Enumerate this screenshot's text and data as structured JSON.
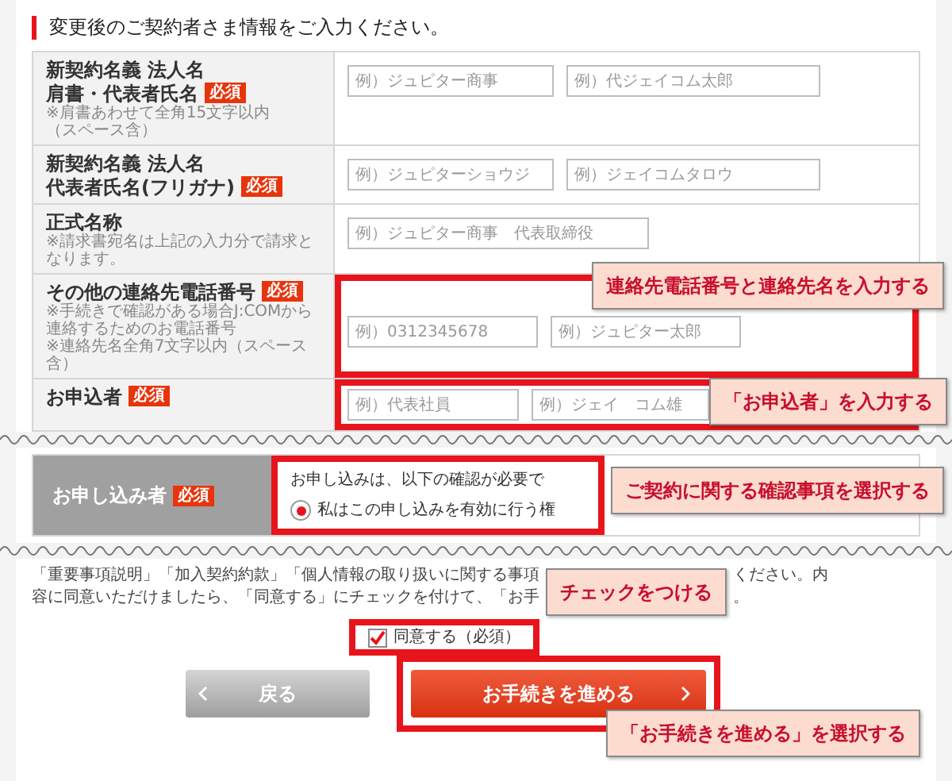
{
  "heading": "変更後のご契約者さま情報をご入力ください。",
  "rows": [
    {
      "label_lines": [
        "新契約名義 法人名",
        "肩書・代表者氏名"
      ],
      "badge": "必須",
      "notes": [
        "※肩書あわせて全角15文字以内",
        "（スペース含）"
      ],
      "fields": [
        {
          "placeholder": "例）ジュピター商事"
        },
        {
          "placeholder": "例）代ジェイコム太郎"
        }
      ],
      "highlighted": false
    },
    {
      "label_lines": [
        "新契約名義 法人名",
        "代表者氏名(フリガナ)"
      ],
      "badge": "必須",
      "notes": [],
      "fields": [
        {
          "placeholder": "例）ジュピターショウジ"
        },
        {
          "placeholder": "例）ジェイコムタロウ"
        }
      ],
      "highlighted": false
    },
    {
      "label_lines": [
        "正式名称"
      ],
      "notes": [
        "※請求書宛名は上記の入力分で請求となります。"
      ],
      "fields": [
        {
          "placeholder": "例）ジュピター商事　代表取締役"
        }
      ],
      "highlighted": false
    },
    {
      "label_lines": [
        "その他の連絡先電話番号"
      ],
      "badge": "必須",
      "notes": [
        "※手続きで確認がある場合J:COMから連絡するためのお電話番号",
        "※連絡先名全角7文字以内（スペース含）"
      ],
      "fields": [
        {
          "placeholder": "例）0312345678"
        },
        {
          "placeholder": "例）ジュピター太郎"
        }
      ],
      "highlighted": true,
      "callout": "連絡先電話番号と連絡先名を入力する"
    },
    {
      "label_lines": [
        "お申込者"
      ],
      "badge": "必須",
      "notes": [],
      "fields": [
        {
          "placeholder": "例）代表社員"
        },
        {
          "placeholder": "例）ジェイ　コム雄"
        }
      ],
      "highlighted": true,
      "callout": "「お申込者」を入力する"
    }
  ],
  "applicant": {
    "label": "お申し込み者",
    "badge": "必須",
    "text": "お申し込みは、以下の確認が必要で",
    "radio": {
      "label": "私はこの申し込みを有効に行う権",
      "selected": true
    },
    "highlighted": true,
    "callout": "ご契約に関する確認事項を選択する"
  },
  "agreement": {
    "lines_left": [
      "「重要事項説明」「加入契約約款」「個人情報の取り扱いに関する事項",
      "容に同意いただけましたら、「同意する」にチェックを付けて、「お手"
    ],
    "lines_right": [
      "ください。内",
      "。"
    ],
    "callout": "チェックをつける",
    "checkbox": {
      "label": "同意する（必須）",
      "checked": true,
      "highlighted": true
    }
  },
  "buttons": [
    {
      "kind": "back",
      "label": "戻る",
      "highlighted": false
    },
    {
      "kind": "next",
      "label": "お手続きを進める",
      "highlighted": true,
      "callout": "「お手続きを進める」を選択する"
    }
  ]
}
